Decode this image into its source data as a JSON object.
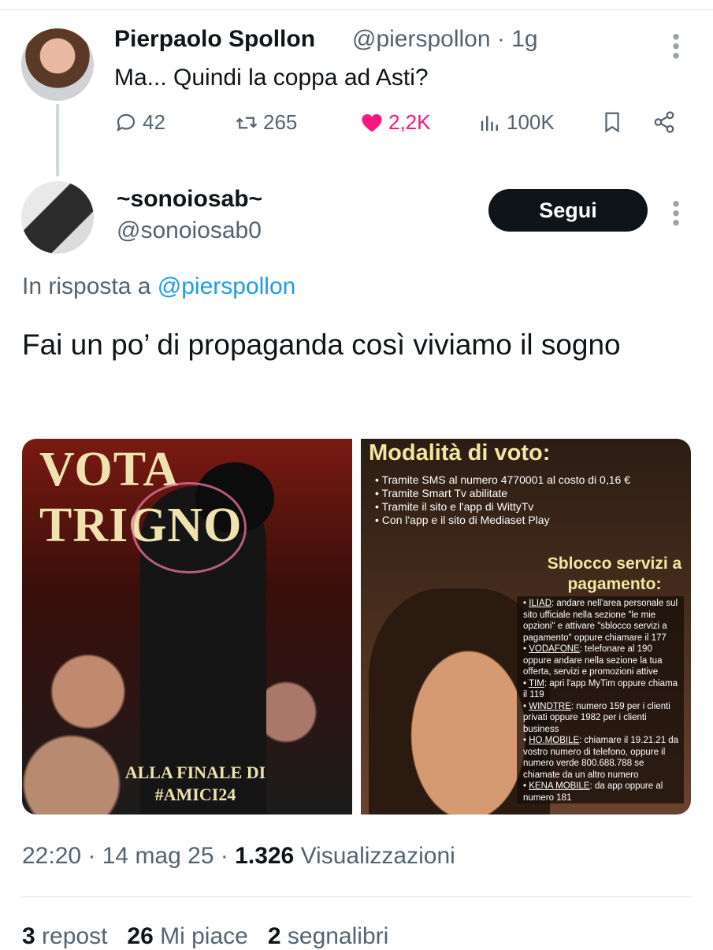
{
  "parent_tweet": {
    "display_name": "Pierpaolo Spollon",
    "handle_time": "@pierspollon · 1g",
    "text": "Ma... Quindi la coppa ad Asti?",
    "actions": {
      "replies": "42",
      "reposts": "265",
      "likes": "2,2K",
      "views": "100K"
    }
  },
  "reply_tweet": {
    "display_name": "~sonoiosab~",
    "handle": "@sonoiosab0",
    "follow_label": "Segui",
    "reply_prefix": "In risposta a",
    "reply_handle": "@pierspollon",
    "text": "Fai un po’ di propaganda così viviamo il sogno",
    "media": {
      "left": {
        "title": "VOTA TRIGNO",
        "footer_line1": "ALLA FINALE DI",
        "footer_line2": "#AMICI24"
      },
      "right": {
        "title": "Modalità di voto:",
        "modes": [
          "Tramite SMS al numero 4770001 al costo di 0,16 €",
          "Tramite Smart Tv abilitate",
          "Tramite il sito e l'app di WittyTv",
          "Con l'app e il sito di Mediaset Play"
        ],
        "unlock_title": "Sblocco servizi a pagamento:",
        "payment": [
          {
            "op": "ILIAD",
            "text": ": andare nell'area personale sul sito ufficiale nella sezione \"le mie opzioni\" e attivare \"sblocco servizi a pagamento\" oppure chiamare il 177"
          },
          {
            "op": "VODAFONE",
            "text": ": telefonare al 190 oppure andare nella sezione la tua offerta, servizi e promozioni attive"
          },
          {
            "op": "TIM",
            "text": ": apri l'app MyTim oppure chiama il 119"
          },
          {
            "op": "WINDTRE",
            "text": ": numero 159 per i clienti privati oppure 1982 per i clienti business"
          },
          {
            "op": "HO.MOBILE",
            "text": ": chiamare il 19.21.21 da vostro numero di telefono, oppure il numero verde 800.688.788 se chiamate da un altro numero"
          },
          {
            "op": "KENA MOBILE",
            "text": ": da app oppure al numero 181"
          }
        ]
      }
    },
    "timestamp": "22:20 · 14 mag 25 · ",
    "views_count": "1.326",
    "views_label": " Visualizzazioni",
    "reposts_count": "3",
    "reposts_label": " repost",
    "likes_count": "26",
    "likes_label": " Mi piace",
    "bookmarks_count": "2",
    "bookmarks_label": " segnalibri"
  },
  "colors": {
    "accent": "#1d9bf0",
    "like": "#f91880",
    "text": "#0f1419",
    "muted": "#536471"
  }
}
